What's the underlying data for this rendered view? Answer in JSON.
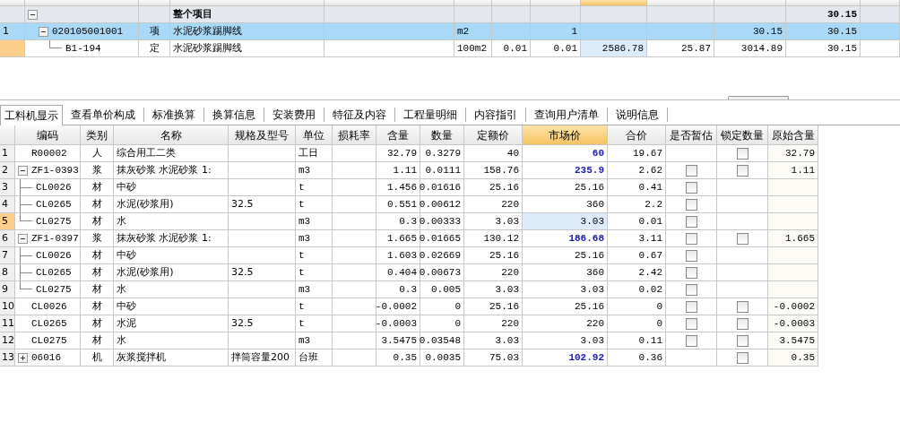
{
  "top_grid": {
    "columns": [
      {
        "selected": false
      },
      {
        "selected": false
      },
      {
        "selected": false
      },
      {
        "selected": false
      },
      {
        "selected": false
      },
      {
        "selected": false
      },
      {
        "selected": false
      },
      {
        "selected": false
      },
      {
        "selected": true
      },
      {
        "selected": false
      },
      {
        "selected": false
      },
      {
        "selected": false
      },
      {
        "selected": false
      }
    ],
    "rows": [
      {
        "kind": "summary",
        "selected": false,
        "highlighted": false,
        "expanded": true,
        "name": "整个项目",
        "total": "30.15",
        "children": [
          {
            "selected": false,
            "highlighted": true,
            "expanded": true,
            "row_number": "1",
            "code": "020105001001",
            "type": "项",
            "name": "水泥砂浆踢脚线",
            "unit": "m2",
            "quantity": "1",
            "unit_total": "30.15",
            "total": "30.15",
            "children": [
              {
                "selected": true,
                "highlighted": false,
                "code": "B1-194",
                "type": "定",
                "name": "水泥砂浆踢脚线",
                "unit": "100m2",
                "content": "0.01",
                "quantity": "0.01",
                "unit_price": "2586.78",
                "price": "25.87",
                "unit_total": "3014.89",
                "total": "30.15"
              }
            ]
          }
        ]
      }
    ]
  },
  "tabs": [
    {
      "label": "工料机显示",
      "selected": true
    },
    {
      "label": "查看单价构成",
      "selected": false
    },
    {
      "label": "标准换算",
      "selected": false
    },
    {
      "label": "换算信息",
      "selected": false
    },
    {
      "label": "安装费用",
      "selected": false
    },
    {
      "label": "特征及内容",
      "selected": false
    },
    {
      "label": "工程量明细",
      "selected": false
    },
    {
      "label": "内容指引",
      "selected": false
    },
    {
      "label": "查询用户清单",
      "selected": false
    },
    {
      "label": "说明信息",
      "selected": false
    }
  ],
  "resource_grid": {
    "columns": [
      {
        "selected": false
      },
      {
        "label": "编码",
        "selected": false
      },
      {
        "label": "类别",
        "selected": false
      },
      {
        "label": "名称",
        "selected": false
      },
      {
        "label": "规格及型号",
        "selected": false
      },
      {
        "label": "单位",
        "selected": false
      },
      {
        "label": "损耗率",
        "selected": false
      },
      {
        "label": "含量",
        "selected": false
      },
      {
        "label": "数量",
        "selected": false
      },
      {
        "label": "定额价",
        "selected": false
      },
      {
        "label": "市场价",
        "selected": true
      },
      {
        "label": "合价",
        "selected": false
      },
      {
        "label": "是否暂估",
        "selected": false
      },
      {
        "label": "锁定数量",
        "selected": false
      },
      {
        "label": "原始含量",
        "selected": false
      }
    ],
    "rows": [
      {
        "row_number": "1",
        "selected": false,
        "code": "R00002",
        "type": "人",
        "name": "综合用工二类",
        "unit": "工日",
        "content": "32.79",
        "amount": "0.3279",
        "quota_price": "40",
        "market_price": "60",
        "price_adjusted": true,
        "total": "19.67",
        "lock_checked": false,
        "original_content": "32.79"
      },
      {
        "row_number": "2",
        "selected": false,
        "expanded": true,
        "code": "ZF1-0393",
        "type": "浆",
        "name": "抹灰砂浆 水泥砂浆 1:",
        "unit": "m3",
        "content": "1.11",
        "amount": "0.0111",
        "quota_price": "158.76",
        "market_price": "235.9",
        "price_adjusted": true,
        "total": "2.62",
        "estimate_checked": false,
        "lock_checked": false,
        "original_content": "1.11",
        "children": [
          {
            "row_number": "3",
            "selected": false,
            "code": "CL0026",
            "type": "材",
            "name": "中砂",
            "unit": "t",
            "content": "1.456",
            "amount": "0.01616",
            "quota_price": "25.16",
            "market_price": "25.16",
            "price_adjusted": false,
            "total": "0.41",
            "estimate_checked": false
          },
          {
            "row_number": "4",
            "selected": false,
            "code": "CL0265",
            "type": "材",
            "name": "水泥(砂浆用)",
            "spec": "32.5",
            "unit": "t",
            "content": "0.551",
            "amount": "0.00612",
            "quota_price": "220",
            "market_price": "360",
            "price_adjusted": false,
            "total": "2.2",
            "estimate_checked": false
          },
          {
            "row_number": "5",
            "selected": true,
            "code": "CL0275",
            "type": "材",
            "name": "水",
            "unit": "m3",
            "content": "0.3",
            "amount": "0.00333",
            "quota_price": "3.03",
            "market_price": "3.03",
            "price_adjusted": false,
            "total": "0.01",
            "estimate_checked": false
          }
        ]
      },
      {
        "row_number": "6",
        "selected": false,
        "expanded": true,
        "code": "ZF1-0397",
        "type": "浆",
        "name": "抹灰砂浆 水泥砂浆 1:",
        "unit": "m3",
        "content": "1.665",
        "amount": "0.01665",
        "quota_price": "130.12",
        "market_price": "186.68",
        "price_adjusted": true,
        "total": "3.11",
        "estimate_checked": false,
        "lock_checked": false,
        "original_content": "1.665",
        "children": [
          {
            "row_number": "7",
            "selected": false,
            "code": "CL0026",
            "type": "材",
            "name": "中砂",
            "unit": "t",
            "content": "1.603",
            "amount": "0.02669",
            "quota_price": "25.16",
            "market_price": "25.16",
            "price_adjusted": false,
            "total": "0.67",
            "estimate_checked": false
          },
          {
            "row_number": "8",
            "selected": false,
            "code": "CL0265",
            "type": "材",
            "name": "水泥(砂浆用)",
            "spec": "32.5",
            "unit": "t",
            "content": "0.404",
            "amount": "0.00673",
            "quota_price": "220",
            "market_price": "360",
            "price_adjusted": false,
            "total": "2.42",
            "estimate_checked": false
          },
          {
            "row_number": "9",
            "selected": false,
            "code": "CL0275",
            "type": "材",
            "name": "水",
            "unit": "m3",
            "content": "0.3",
            "amount": "0.005",
            "quota_price": "3.03",
            "market_price": "3.03",
            "price_adjusted": false,
            "total": "0.02",
            "estimate_checked": false
          }
        ]
      },
      {
        "row_number": "10",
        "selected": false,
        "code": "CL0026",
        "type": "材",
        "name": "中砂",
        "unit": "t",
        "content": "-0.0002",
        "amount": "0",
        "quota_price": "25.16",
        "market_price": "25.16",
        "price_adjusted": false,
        "total": "0",
        "estimate_checked": false,
        "lock_checked": false,
        "original_content": "-0.0002"
      },
      {
        "row_number": "11",
        "selected": false,
        "code": "CL0265",
        "type": "材",
        "name": "水泥",
        "spec": "32.5",
        "unit": "t",
        "content": "-0.0003",
        "amount": "0",
        "quota_price": "220",
        "market_price": "220",
        "price_adjusted": false,
        "total": "0",
        "estimate_checked": false,
        "lock_checked": false,
        "original_content": "-0.0003"
      },
      {
        "row_number": "12",
        "selected": false,
        "code": "CL0275",
        "type": "材",
        "name": "水",
        "unit": "m3",
        "content": "3.5475",
        "amount": "0.03548",
        "quota_price": "3.03",
        "market_price": "3.03",
        "price_adjusted": false,
        "total": "0.11",
        "estimate_checked": false,
        "lock_checked": false,
        "original_content": "3.5475"
      },
      {
        "row_number": "13",
        "selected": false,
        "expanded": false,
        "code": "06016",
        "type": "机",
        "name": "灰浆搅拌机",
        "spec": "拌筒容量200",
        "unit": "台班",
        "content": "0.35",
        "amount": "0.0035",
        "quota_price": "75.03",
        "market_price": "102.92",
        "price_adjusted": true,
        "total": "0.36",
        "lock_checked": false,
        "original_content": "0.35"
      }
    ]
  }
}
